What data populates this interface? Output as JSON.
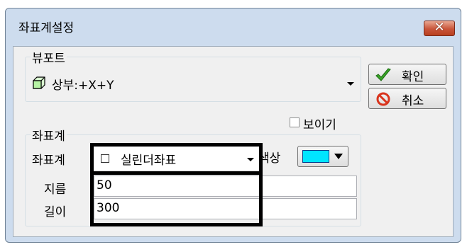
{
  "window": {
    "title": "좌표계설정",
    "close_glyph": "✕"
  },
  "viewport": {
    "group_label": "뷰포트",
    "selected_value": "상부:+X+Y",
    "icon": "cube-icon"
  },
  "buttons": {
    "ok_label": "확인",
    "cancel_label": "취소",
    "ok_icon": "checkmark-icon",
    "cancel_icon": "no-entry-icon"
  },
  "show_checkbox": {
    "label": "보이기",
    "checked": false
  },
  "coordinate": {
    "group_label": "좌표계",
    "type_label": "좌표계",
    "type_value": "실린더좌표",
    "color_label": "색상",
    "color_value": "#00e5ff",
    "diameter_label": "지름",
    "diameter_value": "50",
    "length_label": "길이",
    "length_value": "300"
  }
}
